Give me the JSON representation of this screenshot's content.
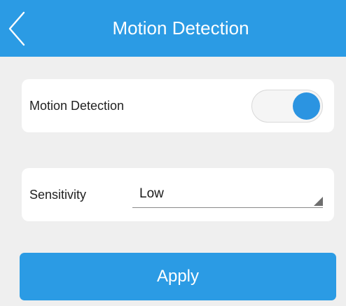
{
  "header": {
    "title": "Motion Detection",
    "back_icon": "chevron-left-icon"
  },
  "motion_detection": {
    "label": "Motion Detection",
    "enabled": true
  },
  "sensitivity": {
    "label": "Sensitivity",
    "selected_value": "Low",
    "dropdown_icon": "triangle-down-right-icon"
  },
  "apply": {
    "label": "Apply"
  },
  "colors": {
    "accent": "#2b9be4",
    "background": "#efefef",
    "card": "#ffffff"
  }
}
